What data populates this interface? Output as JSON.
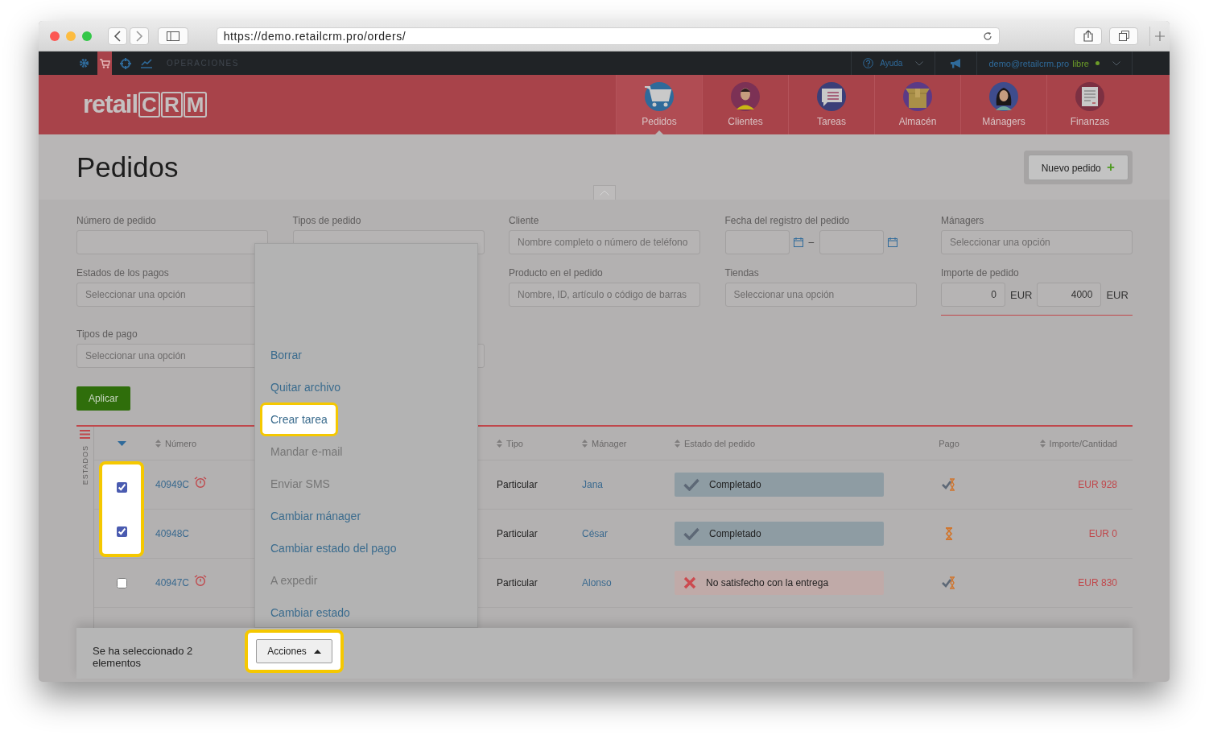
{
  "browser": {
    "url": "https://demo.retailcrm.pro/orders/"
  },
  "topbar": {
    "modules": [
      {
        "selected": false
      },
      {
        "selected": true
      },
      {
        "selected": false
      },
      {
        "selected": false
      }
    ],
    "section": "OPERACIONES",
    "help": "Ayuda",
    "user": "demo@retailcrm.pro",
    "plan": "libre"
  },
  "logo": {
    "prefix": "retail",
    "letters": [
      "C",
      "R",
      "M"
    ]
  },
  "nav": [
    {
      "label": "Pedidos",
      "selected": true
    },
    {
      "label": "Clientes",
      "selected": false
    },
    {
      "label": "Tareas",
      "selected": false
    },
    {
      "label": "Almacén",
      "selected": false
    },
    {
      "label": "Mánagers",
      "selected": false
    },
    {
      "label": "Finanzas",
      "selected": false
    }
  ],
  "page": {
    "title": "Pedidos",
    "new_button": "Nuevo pedido",
    "new_button_icon": "+"
  },
  "filters": [
    {
      "kind": "text",
      "label": "Número de pedido"
    },
    {
      "kind": "select",
      "label": "Tipos de pedido"
    },
    {
      "kind": "text",
      "label": "Cliente",
      "placeholder": "Nombre completo o número de teléfono"
    },
    {
      "kind": "date-range",
      "label": "Fecha del registro del pedido",
      "separator": "–"
    },
    {
      "kind": "select",
      "label": "Mánagers",
      "placeholder": "Seleccionar una opción"
    },
    {
      "kind": "select",
      "label": "Estados de los pagos",
      "placeholder": "Seleccionar una opción"
    },
    {
      "kind": "empty"
    },
    {
      "kind": "text",
      "label": "Producto en el pedido",
      "placeholder": "Nombre, ID, artículo o código de barras"
    },
    {
      "kind": "select",
      "label": "Tiendas",
      "placeholder": "Seleccionar una opción"
    },
    {
      "kind": "amount-range",
      "label": "Importe de pedido",
      "from": "0",
      "to": "4000",
      "currency_from": "EUR",
      "currency_to": "EUR"
    },
    {
      "kind": "select",
      "label": "Tipos de pago",
      "placeholder": "Seleccionar una opción"
    },
    {
      "kind": "select"
    }
  ],
  "apply_button": "Aplicar",
  "table": {
    "side_label": "ESTADOS",
    "columns": [
      {
        "label": "Número",
        "sortable": true
      },
      {
        "label": "Tipo",
        "sortable": true
      },
      {
        "label": "Mánager",
        "sortable": true
      },
      {
        "label": "Estado del pedido",
        "sortable": true
      },
      {
        "label": "Pago",
        "sortable": false
      },
      {
        "label": "Importe/Cantidad",
        "sortable": true
      }
    ],
    "rows": [
      {
        "checked": true,
        "number": "40949C",
        "alarm": true,
        "type": "Particular",
        "manager": "Jana",
        "status": {
          "kind": "done",
          "label": "Completado"
        },
        "payment": {
          "kind": "paid-pending"
        },
        "amount": "EUR 928"
      },
      {
        "checked": true,
        "number": "40948C",
        "alarm": false,
        "type": "Particular",
        "manager": "César",
        "status": {
          "kind": "done",
          "label": "Completado"
        },
        "payment": {
          "kind": "pending"
        },
        "amount": "EUR 0"
      },
      {
        "checked": false,
        "number": "40947C",
        "alarm": true,
        "type": "Particular",
        "manager": "Alonso",
        "status": {
          "kind": "failed",
          "label": "No satisfecho con la entrega"
        },
        "payment": {
          "kind": "paid-pending"
        },
        "amount": "EUR 830"
      }
    ]
  },
  "menu": {
    "items": [
      {
        "label": "Borrar",
        "disabled": false,
        "highlighted": false
      },
      {
        "label": "Quitar archivo",
        "disabled": false,
        "highlighted": false
      },
      {
        "label": "Crear tarea",
        "disabled": false,
        "highlighted": true
      },
      {
        "label": "Mandar e-mail",
        "disabled": true,
        "highlighted": false
      },
      {
        "label": "Enviar SMS",
        "disabled": true,
        "highlighted": false
      },
      {
        "label": "Cambiar mánager",
        "disabled": false,
        "highlighted": false
      },
      {
        "label": "Cambiar estado del pago",
        "disabled": false,
        "highlighted": false
      },
      {
        "label": "A expedir",
        "disabled": true,
        "highlighted": false
      },
      {
        "label": "Cambiar estado",
        "disabled": false,
        "highlighted": false
      }
    ]
  },
  "selection_bar": {
    "text": "Se ha seleccionado 2 elementos",
    "actions": "Acciones",
    "actions_highlighted": true
  }
}
